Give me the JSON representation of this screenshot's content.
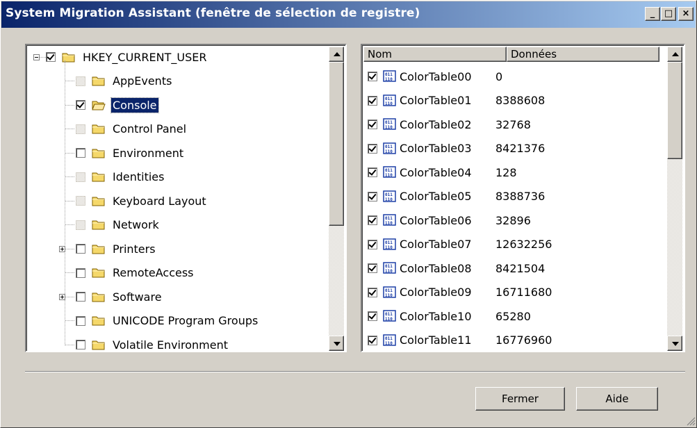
{
  "window": {
    "title": "System Migration Assistant (fenêtre de sélection de registre)",
    "minimize_glyph": "_",
    "maximize_glyph": "□",
    "close_glyph": "×"
  },
  "tree": {
    "root": {
      "label": "HKEY_CURRENT_USER",
      "checked": true,
      "expanded": true
    },
    "items": [
      {
        "label": "AppEvents",
        "check": "grey",
        "expander": "none"
      },
      {
        "label": "Console",
        "check": "on",
        "expander": "none",
        "selected": true,
        "open_folder": true
      },
      {
        "label": "Control Panel",
        "check": "grey",
        "expander": "none"
      },
      {
        "label": "Environment",
        "check": "off",
        "expander": "none"
      },
      {
        "label": "Identities",
        "check": "grey",
        "expander": "none"
      },
      {
        "label": "Keyboard Layout",
        "check": "grey",
        "expander": "none"
      },
      {
        "label": "Network",
        "check": "grey",
        "expander": "none"
      },
      {
        "label": "Printers",
        "check": "off",
        "expander": "plus"
      },
      {
        "label": "RemoteAccess",
        "check": "off",
        "expander": "none"
      },
      {
        "label": "Software",
        "check": "off",
        "expander": "plus"
      },
      {
        "label": "UNICODE Program Groups",
        "check": "off",
        "expander": "none"
      },
      {
        "label": "Volatile Environment",
        "check": "off",
        "expander": "none"
      }
    ]
  },
  "list": {
    "headers": {
      "name": "Nom",
      "data": "Données"
    },
    "rows": [
      {
        "name": "ColorTable00",
        "value": "0"
      },
      {
        "name": "ColorTable01",
        "value": "8388608"
      },
      {
        "name": "ColorTable02",
        "value": "32768"
      },
      {
        "name": "ColorTable03",
        "value": "8421376"
      },
      {
        "name": "ColorTable04",
        "value": "128"
      },
      {
        "name": "ColorTable05",
        "value": "8388736"
      },
      {
        "name": "ColorTable06",
        "value": "32896"
      },
      {
        "name": "ColorTable07",
        "value": "12632256"
      },
      {
        "name": "ColorTable08",
        "value": "8421504"
      },
      {
        "name": "ColorTable09",
        "value": "16711680"
      },
      {
        "name": "ColorTable10",
        "value": "65280"
      },
      {
        "name": "ColorTable11",
        "value": "16776960"
      }
    ]
  },
  "buttons": {
    "close": "Fermer",
    "help": "Aide"
  },
  "colors": {
    "title_start": "#0a246a",
    "title_end": "#a6caf0",
    "face": "#d4d0c8",
    "selection": "#0a246a",
    "folder": "#f5d86a"
  }
}
